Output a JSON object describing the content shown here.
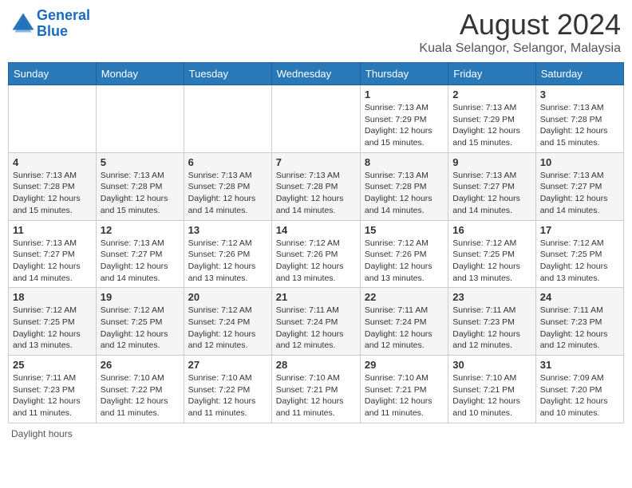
{
  "header": {
    "logo_line1": "General",
    "logo_line2": "Blue",
    "main_title": "August 2024",
    "subtitle": "Kuala Selangor, Selangor, Malaysia"
  },
  "days_of_week": [
    "Sunday",
    "Monday",
    "Tuesday",
    "Wednesday",
    "Thursday",
    "Friday",
    "Saturday"
  ],
  "weeks": [
    [
      {
        "day": "",
        "info": ""
      },
      {
        "day": "",
        "info": ""
      },
      {
        "day": "",
        "info": ""
      },
      {
        "day": "",
        "info": ""
      },
      {
        "day": "1",
        "info": "Sunrise: 7:13 AM\nSunset: 7:29 PM\nDaylight: 12 hours and 15 minutes."
      },
      {
        "day": "2",
        "info": "Sunrise: 7:13 AM\nSunset: 7:29 PM\nDaylight: 12 hours and 15 minutes."
      },
      {
        "day": "3",
        "info": "Sunrise: 7:13 AM\nSunset: 7:28 PM\nDaylight: 12 hours and 15 minutes."
      }
    ],
    [
      {
        "day": "4",
        "info": "Sunrise: 7:13 AM\nSunset: 7:28 PM\nDaylight: 12 hours and 15 minutes."
      },
      {
        "day": "5",
        "info": "Sunrise: 7:13 AM\nSunset: 7:28 PM\nDaylight: 12 hours and 15 minutes."
      },
      {
        "day": "6",
        "info": "Sunrise: 7:13 AM\nSunset: 7:28 PM\nDaylight: 12 hours and 14 minutes."
      },
      {
        "day": "7",
        "info": "Sunrise: 7:13 AM\nSunset: 7:28 PM\nDaylight: 12 hours and 14 minutes."
      },
      {
        "day": "8",
        "info": "Sunrise: 7:13 AM\nSunset: 7:28 PM\nDaylight: 12 hours and 14 minutes."
      },
      {
        "day": "9",
        "info": "Sunrise: 7:13 AM\nSunset: 7:27 PM\nDaylight: 12 hours and 14 minutes."
      },
      {
        "day": "10",
        "info": "Sunrise: 7:13 AM\nSunset: 7:27 PM\nDaylight: 12 hours and 14 minutes."
      }
    ],
    [
      {
        "day": "11",
        "info": "Sunrise: 7:13 AM\nSunset: 7:27 PM\nDaylight: 12 hours and 14 minutes."
      },
      {
        "day": "12",
        "info": "Sunrise: 7:13 AM\nSunset: 7:27 PM\nDaylight: 12 hours and 14 minutes."
      },
      {
        "day": "13",
        "info": "Sunrise: 7:12 AM\nSunset: 7:26 PM\nDaylight: 12 hours and 13 minutes."
      },
      {
        "day": "14",
        "info": "Sunrise: 7:12 AM\nSunset: 7:26 PM\nDaylight: 12 hours and 13 minutes."
      },
      {
        "day": "15",
        "info": "Sunrise: 7:12 AM\nSunset: 7:26 PM\nDaylight: 12 hours and 13 minutes."
      },
      {
        "day": "16",
        "info": "Sunrise: 7:12 AM\nSunset: 7:25 PM\nDaylight: 12 hours and 13 minutes."
      },
      {
        "day": "17",
        "info": "Sunrise: 7:12 AM\nSunset: 7:25 PM\nDaylight: 12 hours and 13 minutes."
      }
    ],
    [
      {
        "day": "18",
        "info": "Sunrise: 7:12 AM\nSunset: 7:25 PM\nDaylight: 12 hours and 13 minutes."
      },
      {
        "day": "19",
        "info": "Sunrise: 7:12 AM\nSunset: 7:25 PM\nDaylight: 12 hours and 12 minutes."
      },
      {
        "day": "20",
        "info": "Sunrise: 7:12 AM\nSunset: 7:24 PM\nDaylight: 12 hours and 12 minutes."
      },
      {
        "day": "21",
        "info": "Sunrise: 7:11 AM\nSunset: 7:24 PM\nDaylight: 12 hours and 12 minutes."
      },
      {
        "day": "22",
        "info": "Sunrise: 7:11 AM\nSunset: 7:24 PM\nDaylight: 12 hours and 12 minutes."
      },
      {
        "day": "23",
        "info": "Sunrise: 7:11 AM\nSunset: 7:23 PM\nDaylight: 12 hours and 12 minutes."
      },
      {
        "day": "24",
        "info": "Sunrise: 7:11 AM\nSunset: 7:23 PM\nDaylight: 12 hours and 12 minutes."
      }
    ],
    [
      {
        "day": "25",
        "info": "Sunrise: 7:11 AM\nSunset: 7:23 PM\nDaylight: 12 hours and 11 minutes."
      },
      {
        "day": "26",
        "info": "Sunrise: 7:10 AM\nSunset: 7:22 PM\nDaylight: 12 hours and 11 minutes."
      },
      {
        "day": "27",
        "info": "Sunrise: 7:10 AM\nSunset: 7:22 PM\nDaylight: 12 hours and 11 minutes."
      },
      {
        "day": "28",
        "info": "Sunrise: 7:10 AM\nSunset: 7:21 PM\nDaylight: 12 hours and 11 minutes."
      },
      {
        "day": "29",
        "info": "Sunrise: 7:10 AM\nSunset: 7:21 PM\nDaylight: 12 hours and 11 minutes."
      },
      {
        "day": "30",
        "info": "Sunrise: 7:10 AM\nSunset: 7:21 PM\nDaylight: 12 hours and 10 minutes."
      },
      {
        "day": "31",
        "info": "Sunrise: 7:09 AM\nSunset: 7:20 PM\nDaylight: 12 hours and 10 minutes."
      }
    ]
  ],
  "footer": {
    "daylight_label": "Daylight hours"
  }
}
